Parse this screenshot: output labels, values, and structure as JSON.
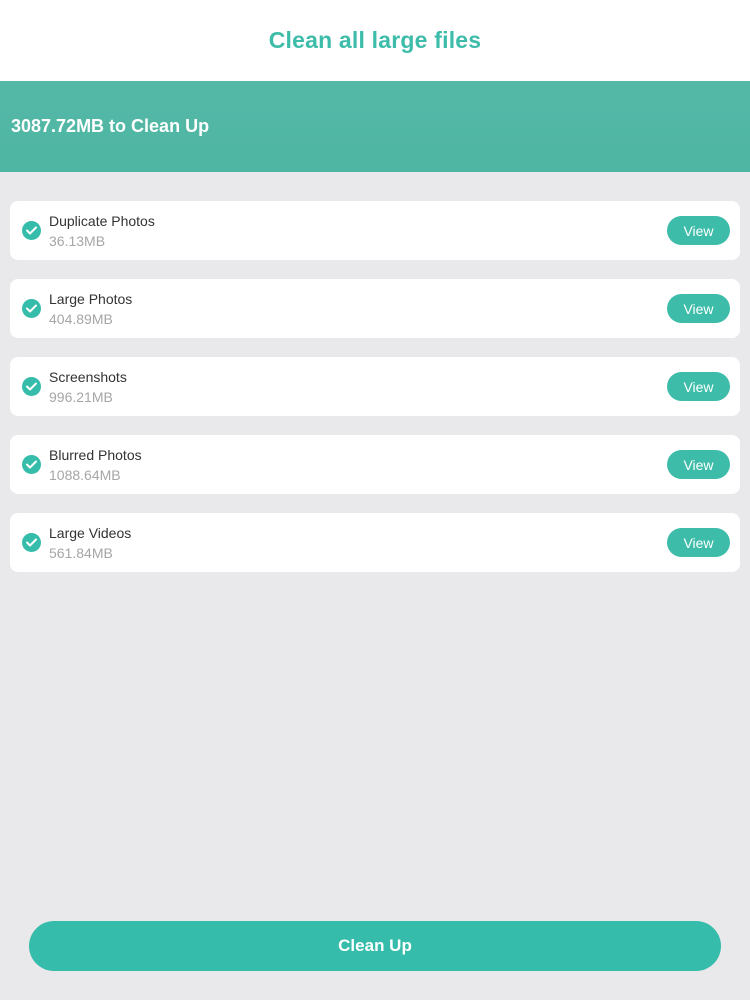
{
  "header": {
    "title": "Clean all large files"
  },
  "summary": {
    "text": "3087.72MB to Clean Up"
  },
  "items": [
    {
      "name": "Duplicate Photos",
      "size": "36.13MB",
      "action": "View",
      "checked": true
    },
    {
      "name": "Large Photos",
      "size": "404.89MB",
      "action": "View",
      "checked": true
    },
    {
      "name": "Screenshots",
      "size": "996.21MB",
      "action": "View",
      "checked": true
    },
    {
      "name": "Blurred Photos",
      "size": "1088.64MB",
      "action": "View",
      "checked": true
    },
    {
      "name": "Large Videos",
      "size": "561.84MB",
      "action": "View",
      "checked": true
    }
  ],
  "footer": {
    "cleanup_label": "Clean Up"
  },
  "colors": {
    "accent": "#3dbca9",
    "banner": "#54b8a7",
    "background": "#e9e8ea"
  }
}
